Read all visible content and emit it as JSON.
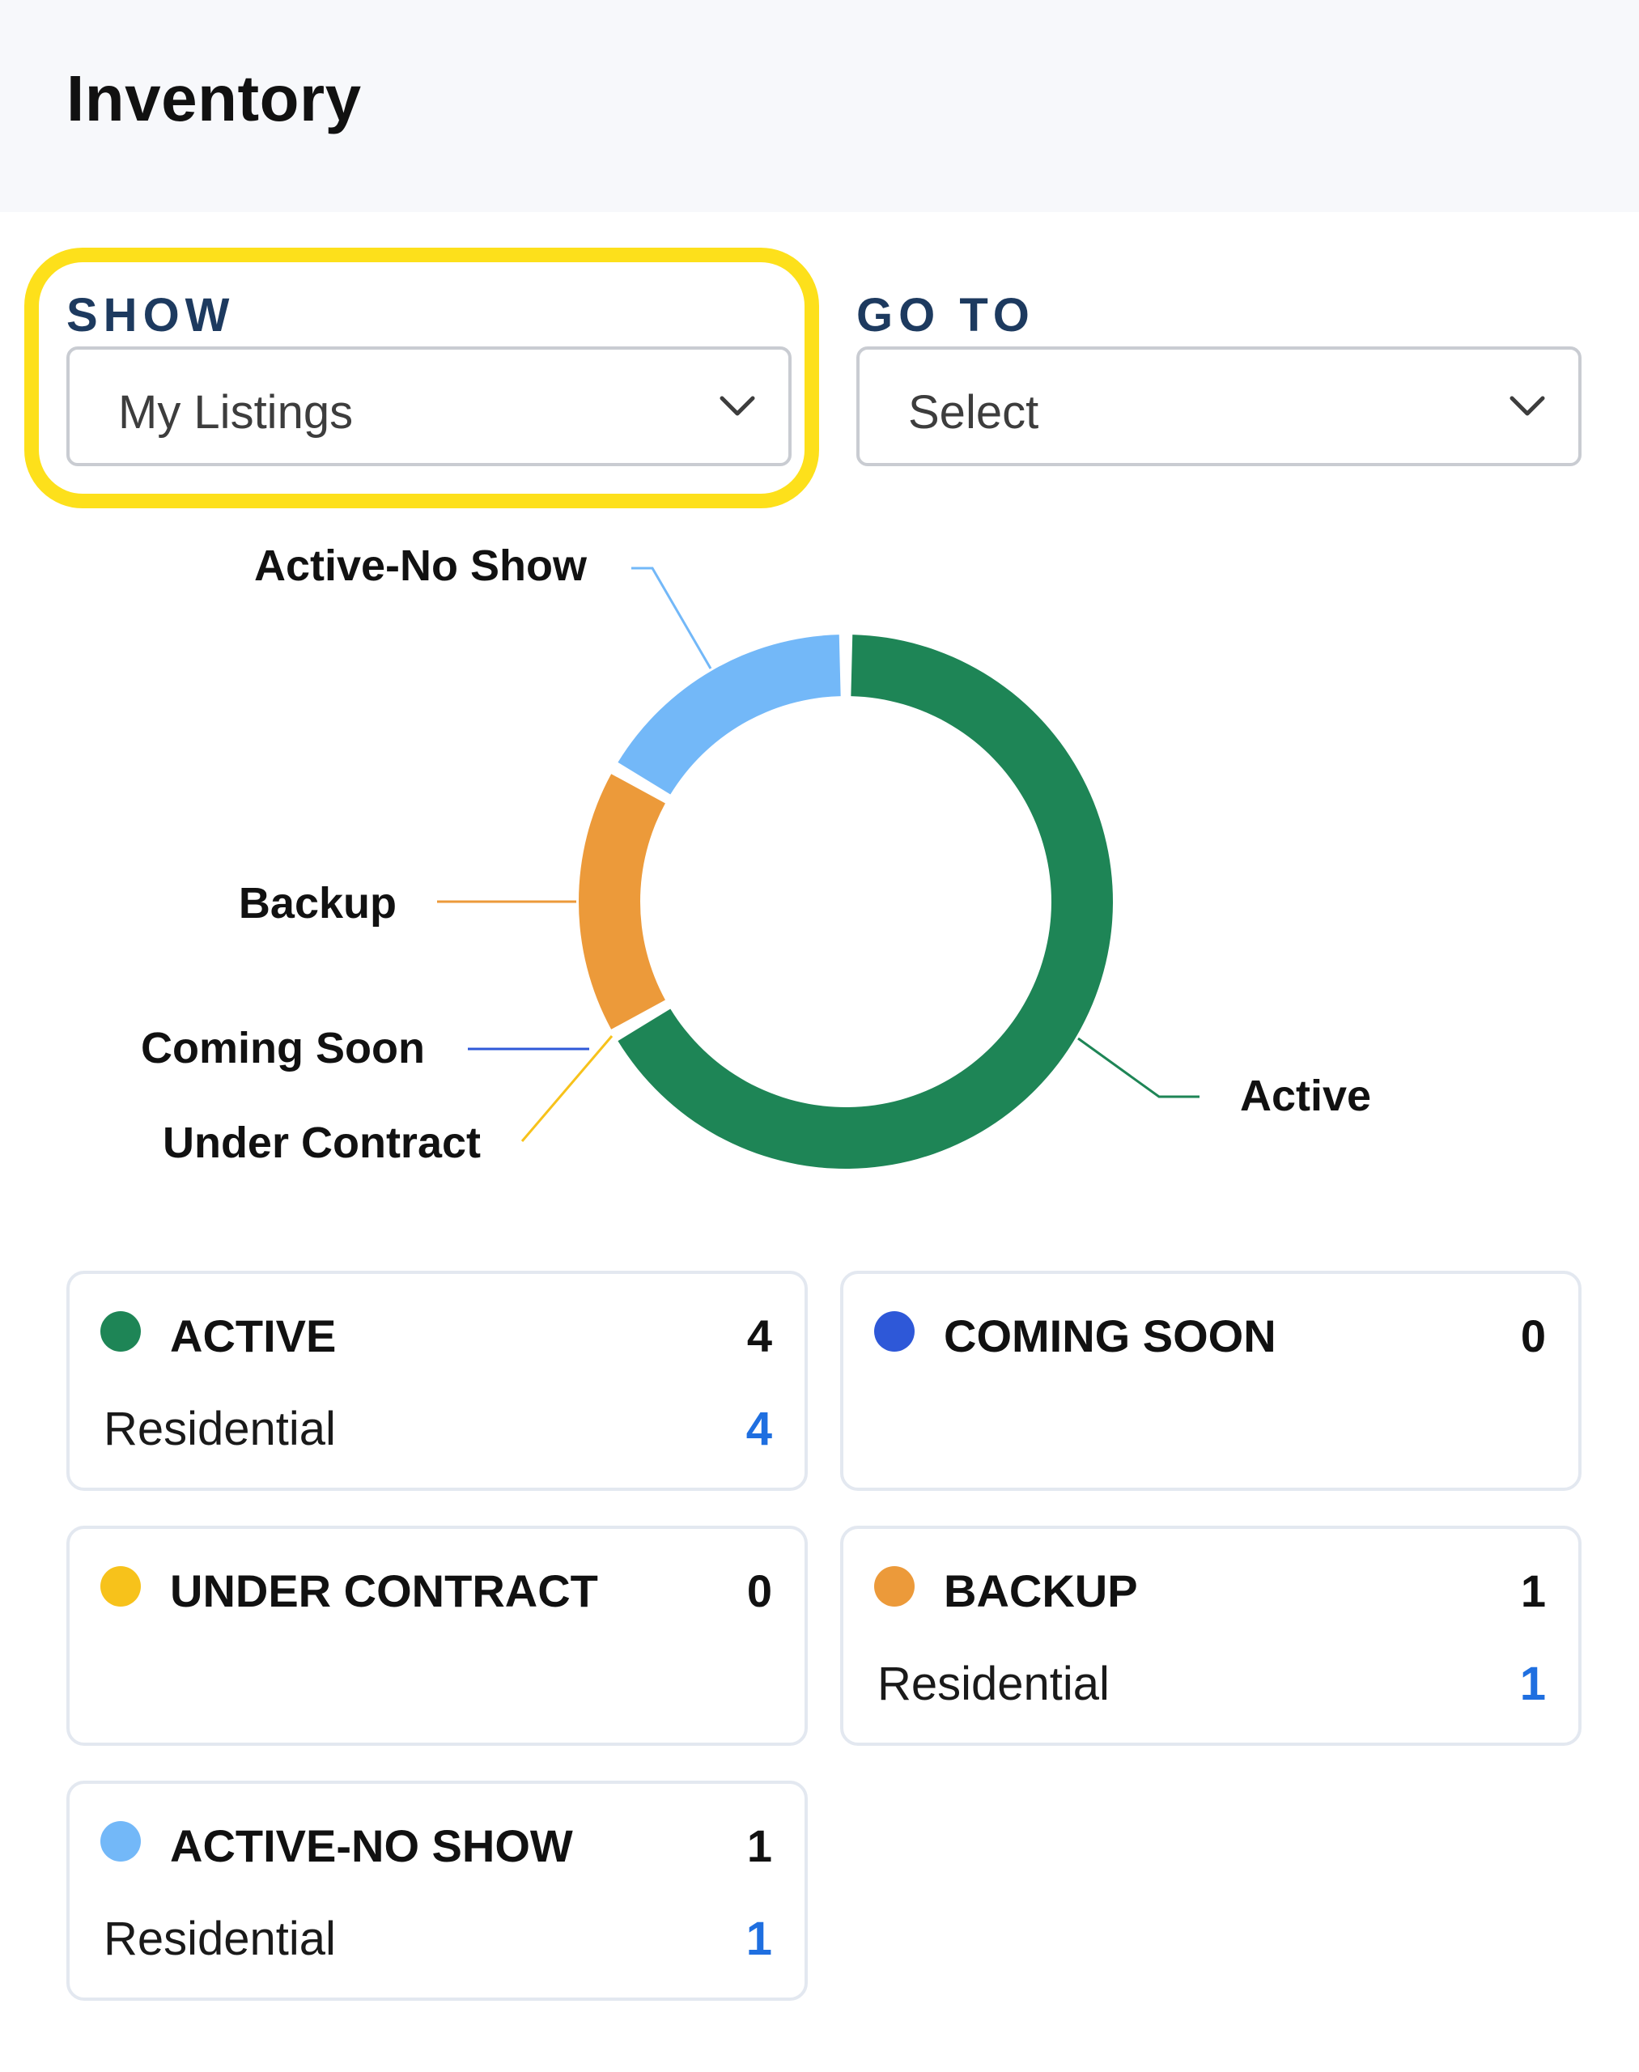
{
  "page": {
    "title": "Inventory"
  },
  "filters": {
    "show": {
      "label": "SHOW",
      "value": "My Listings"
    },
    "goto": {
      "label": "GO TO",
      "value": "Select"
    }
  },
  "colors": {
    "active": "#1e8556",
    "coming_soon": "#2e58d8",
    "under_contract": "#f7c21b",
    "backup": "#ec9a3a",
    "active_no_show": "#73b8f8",
    "link_blue": "#1f6fe0",
    "highlight": "#fde01b"
  },
  "chart_data": {
    "type": "pie",
    "labels": [
      "Active",
      "Coming Soon",
      "Under Contract",
      "Backup",
      "Active-No Show"
    ],
    "values": [
      4,
      0,
      0,
      1,
      1
    ],
    "colors": [
      "#1e8556",
      "#2e58d8",
      "#f7c21b",
      "#ec9a3a",
      "#73b8f8"
    ]
  },
  "cards": [
    {
      "key": "active",
      "title": "ACTIVE",
      "count": "4",
      "sub_label": "Residential",
      "sub_count": "4",
      "color": "#1e8556",
      "dot_icon": "green-dot-icon"
    },
    {
      "key": "coming_soon",
      "title": "COMING SOON",
      "count": "0",
      "sub_label": "",
      "sub_count": "",
      "color": "#2e58d8",
      "dot_icon": "blue-dot-icon"
    },
    {
      "key": "under_contract",
      "title": "UNDER CONTRACT",
      "count": "0",
      "sub_label": "",
      "sub_count": "",
      "color": "#f7c21b",
      "dot_icon": "yellow-dot-icon"
    },
    {
      "key": "backup",
      "title": "BACKUP",
      "count": "1",
      "sub_label": "Residential",
      "sub_count": "1",
      "color": "#ec9a3a",
      "dot_icon": "orange-dot-icon"
    },
    {
      "key": "active_no_show",
      "title": "ACTIVE-NO SHOW",
      "count": "1",
      "sub_label": "Residential",
      "sub_count": "1",
      "color": "#73b8f8",
      "dot_icon": "light-blue-dot-icon"
    }
  ]
}
